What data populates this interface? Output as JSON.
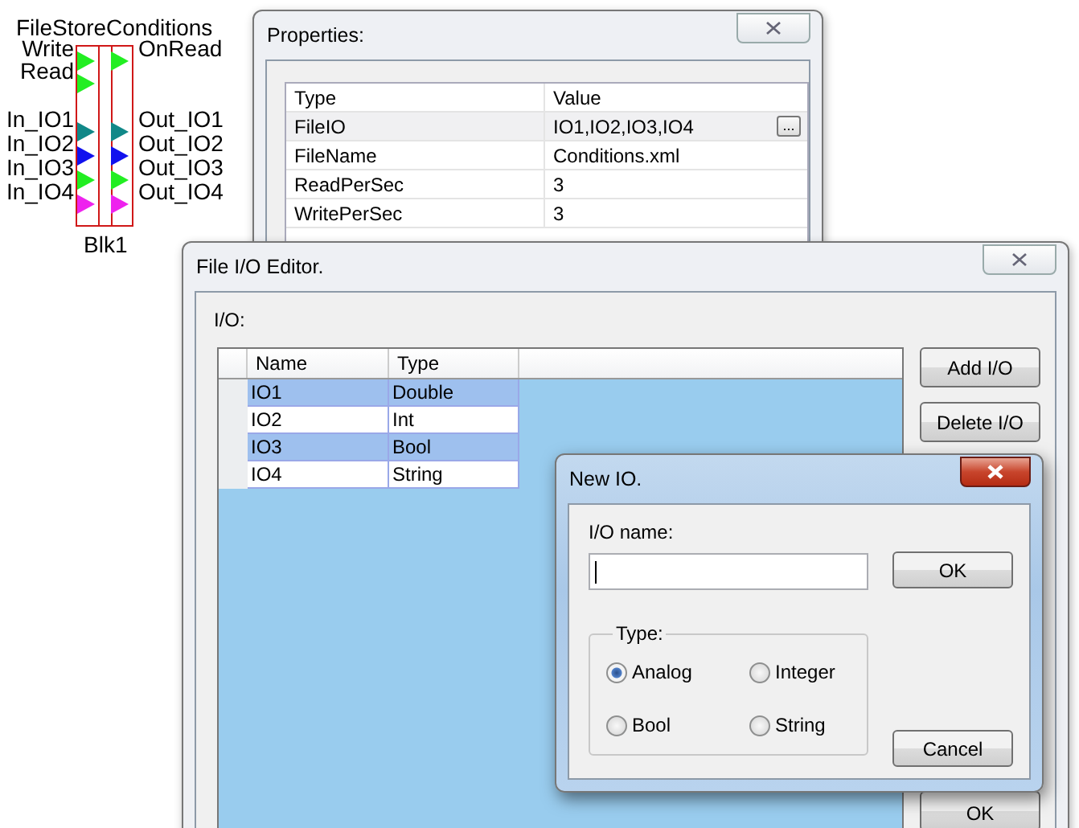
{
  "diagram": {
    "title": "FileStoreConditions",
    "label": "Blk1",
    "inputs": [
      {
        "label": "Write",
        "color": "#22ee22"
      },
      {
        "label": "Read",
        "color": "#22ee22"
      },
      {
        "label": "In_IO1",
        "color": "#118888"
      },
      {
        "label": "In_IO2",
        "color": "#1111ee"
      },
      {
        "label": "In_IO3",
        "color": "#22ee22"
      },
      {
        "label": "In_IO4",
        "color": "#ee22ee"
      }
    ],
    "outputs": [
      {
        "label": "OnRead",
        "color": "#22ee22"
      },
      {
        "label": "Out_IO1",
        "color": "#118888"
      },
      {
        "label": "Out_IO2",
        "color": "#1111ee"
      },
      {
        "label": "Out_IO3",
        "color": "#22ee22"
      },
      {
        "label": "Out_IO4",
        "color": "#ee22ee"
      }
    ]
  },
  "properties_window": {
    "title": "Properties:",
    "columns": [
      "Type",
      "Value"
    ],
    "rows": [
      {
        "name": "FileIO",
        "value": "IO1,IO2,IO3,IO4",
        "selected": true,
        "button": "..."
      },
      {
        "name": "FileName",
        "value": "Conditions.xml",
        "selected": false
      },
      {
        "name": "ReadPerSec",
        "value": "3",
        "selected": false
      },
      {
        "name": "WritePerSec",
        "value": "3",
        "selected": false
      }
    ]
  },
  "file_io_editor": {
    "title": "File I/O Editor.",
    "list_label": "I/O:",
    "columns": [
      "Name",
      "Type"
    ],
    "rows": [
      {
        "name": "IO1",
        "type": "Double",
        "selected": true
      },
      {
        "name": "IO2",
        "type": "Int",
        "selected": false
      },
      {
        "name": "IO3",
        "type": "Bool",
        "selected": true
      },
      {
        "name": "IO4",
        "type": "String",
        "selected": false
      }
    ],
    "buttons": [
      "Add I/O",
      "Delete I/O",
      "OK"
    ]
  },
  "new_io_dialog": {
    "title": "New IO.",
    "name_label": "I/O name:",
    "type_group": {
      "label": "Type:",
      "options": [
        {
          "label": "Analog",
          "selected": true
        },
        {
          "label": "Integer",
          "selected": false
        },
        {
          "label": "Bool",
          "selected": false
        },
        {
          "label": "String",
          "selected": false
        }
      ]
    },
    "buttons": [
      "OK",
      "Cancel"
    ]
  }
}
